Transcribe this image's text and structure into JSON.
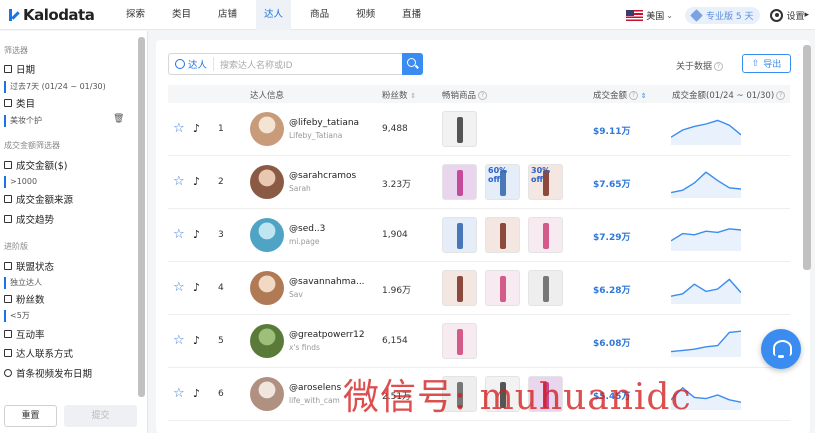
{
  "app": {
    "logo": "Kalodata"
  },
  "nav": [
    "探索",
    "类目",
    "店铺",
    "达人",
    "商品",
    "视频",
    "直播"
  ],
  "nav_active": "达人",
  "top_right": {
    "country": "美国",
    "pro_label": "专业版 5 天",
    "settings": "设置"
  },
  "sidebar": {
    "filter_head": "筛选器",
    "date_label": "日期",
    "date_value": "过去7天 (01/24 ~ 01/30)",
    "category_label": "类目",
    "category_value": "美妆个护",
    "gmv_head": "成交金额筛选器",
    "gmv_label": "成交金额($)",
    "gmv_value": ">1000",
    "gmv_source": "成交金额来源",
    "gmv_trend": "成交趋势",
    "advanced_head": "进阶版",
    "affiliate_status": "联盟状态",
    "affiliate_value": "独立达人",
    "fans_label": "粉丝数",
    "fans_value": "<5万",
    "interaction": "互动率",
    "contact": "达人联系方式",
    "first_video": "首条视频发布日期",
    "reset": "重置",
    "submit": "提交"
  },
  "toolbar": {
    "search_type": "达人",
    "search_placeholder": "搜索达人名称或ID",
    "about": "关于数据",
    "export": "导出"
  },
  "table": {
    "headers": {
      "creator": "达人信息",
      "fans": "粉丝数",
      "products": "畅销商品",
      "gmv": "成交金额",
      "trend": "成交金额(01/24 ~ 01/30)"
    },
    "rows": [
      {
        "rank": "1",
        "handle": "@lifeby_tatiana",
        "nick": "Lifeby_Tatiana",
        "fans": "9,488",
        "gmv": "$9.11万",
        "products": 1,
        "trend": [
          0.2,
          0.5,
          0.65,
          0.75,
          0.9,
          0.7,
          0.3
        ]
      },
      {
        "rank": "2",
        "handle": "@sarahcramos",
        "nick": "Sarah",
        "fans": "3.23万",
        "gmv": "$7.65万",
        "products": 3,
        "badges": [
          "60% off",
          "30% off"
        ],
        "trend": [
          0.1,
          0.2,
          0.5,
          0.95,
          0.6,
          0.3,
          0.25
        ]
      },
      {
        "rank": "3",
        "handle": "@sed..3",
        "nick": "mi.page",
        "fans": "1,904",
        "gmv": "$7.29万",
        "products": 3,
        "trend": [
          0.3,
          0.6,
          0.55,
          0.7,
          0.65,
          0.8,
          0.75
        ]
      },
      {
        "rank": "4",
        "handle": "@savannahma...",
        "nick": "Sav",
        "fans": "1.96万",
        "gmv": "$6.28万",
        "products": 3,
        "trend": [
          0.2,
          0.3,
          0.7,
          0.4,
          0.5,
          0.9,
          0.35
        ]
      },
      {
        "rank": "5",
        "handle": "@greatpowerr12",
        "nick": "x's finds",
        "fans": "6,154",
        "gmv": "$6.08万",
        "products": 1,
        "trend": [
          0.1,
          0.15,
          0.2,
          0.3,
          0.35,
          0.9,
          0.95
        ]
      },
      {
        "rank": "6",
        "handle": "@aroselens",
        "nick": "life_with_cam",
        "fans": "2.51万",
        "gmv": "$5.45万",
        "products": 3,
        "trend": [
          0.3,
          0.8,
          0.4,
          0.35,
          0.5,
          0.3,
          0.2
        ]
      }
    ]
  },
  "watermark": "微信号: muhuanidc"
}
